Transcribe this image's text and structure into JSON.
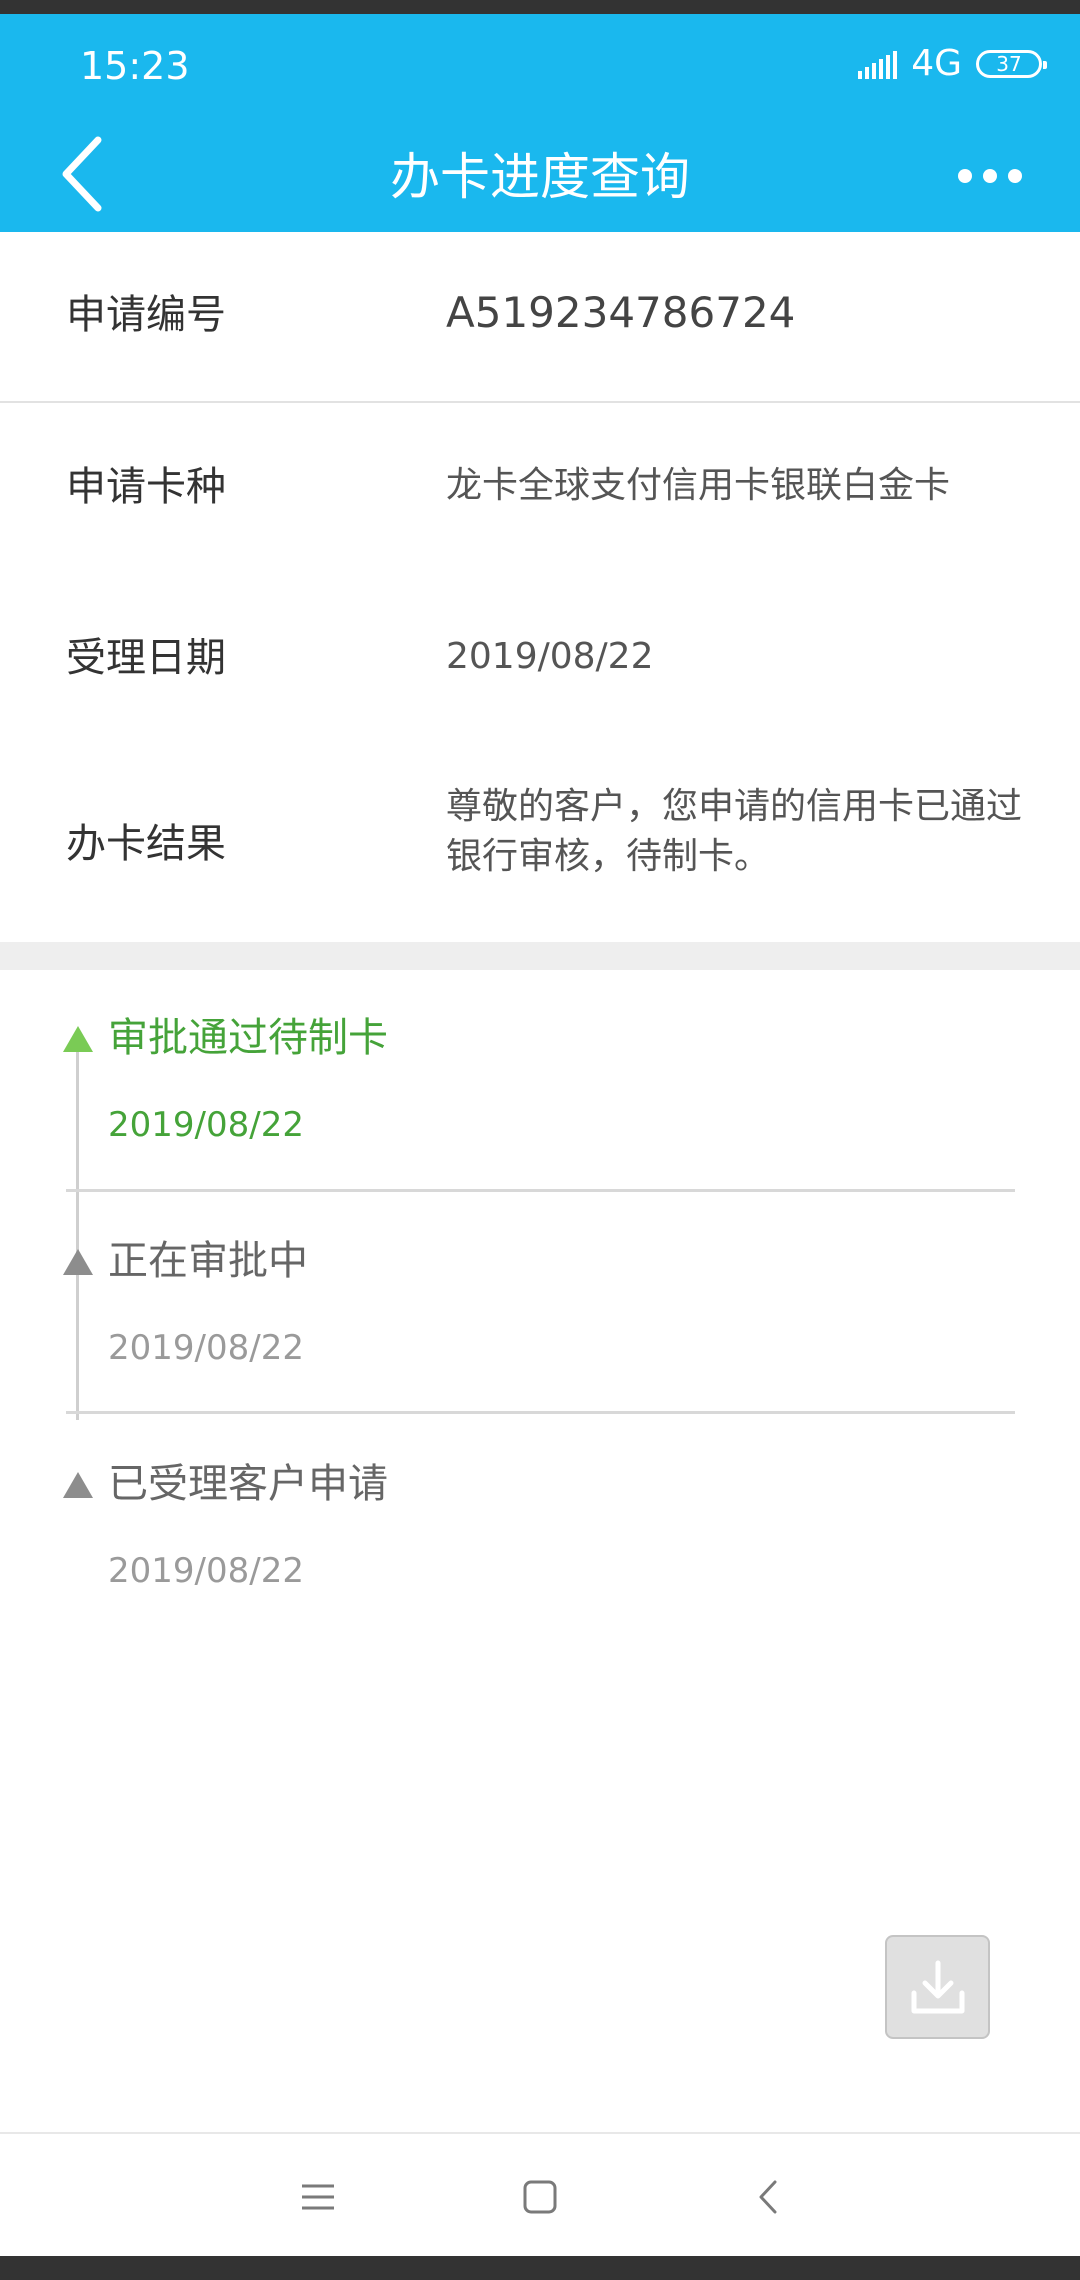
{
  "status_bar": {
    "time": "15:23",
    "network": "4G",
    "battery": "37"
  },
  "header": {
    "title": "办卡进度查询",
    "back_icon": "chevron-left-icon",
    "more_icon": "more-dots-icon"
  },
  "info": {
    "rows": [
      {
        "label": "申请编号",
        "value": "A519234786724"
      },
      {
        "label": "申请卡种",
        "value": "龙卡全球支付信用卡银联白金卡"
      },
      {
        "label": "受理日期",
        "value": "2019/08/22"
      },
      {
        "label": "办卡结果",
        "value": "尊敬的客户，您申请的信用卡已通过银行审核，待制卡。"
      }
    ]
  },
  "timeline": {
    "items": [
      {
        "title": "审批通过待制卡",
        "date": "2019/08/22",
        "active": true
      },
      {
        "title": "正在审批中",
        "date": "2019/08/22",
        "active": false
      },
      {
        "title": "已受理客户申请",
        "date": "2019/08/22",
        "active": false
      }
    ]
  },
  "actions": {
    "download_icon": "download-icon"
  },
  "nav": {
    "menu_icon": "menu-icon",
    "home_icon": "home-square-icon",
    "back_icon": "back-triangle-icon"
  },
  "colors": {
    "header_bg": "#1ab8ee",
    "active_green": "#45a339",
    "marker_green": "#7acb55",
    "inactive_gray": "#8d8d8d"
  }
}
